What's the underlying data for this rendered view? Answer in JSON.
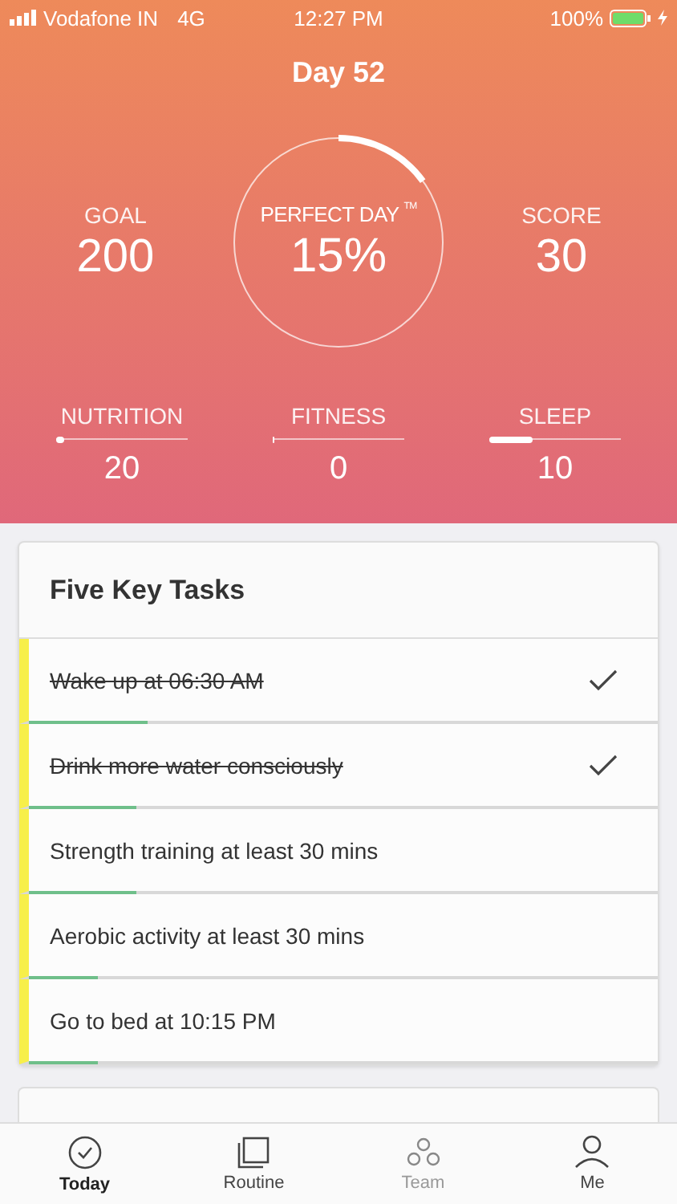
{
  "status_bar": {
    "carrier": "Vodafone IN",
    "network": "4G",
    "time": "12:27 PM",
    "battery": "100%"
  },
  "header": {
    "title": "Day 52",
    "goal": {
      "label": "GOAL",
      "value": "200"
    },
    "perfect_day": {
      "label": "PERFECT DAY",
      "mark": "TM",
      "value": "15%",
      "level": 0.15
    },
    "score": {
      "label": "SCORE",
      "value": "30"
    },
    "categories": [
      {
        "label": "NUTRITION",
        "level": 0.06,
        "value": "20"
      },
      {
        "label": "FITNESS",
        "level": 0,
        "value": "0"
      },
      {
        "label": "SLEEP",
        "level": 0.33,
        "value": "10"
      }
    ]
  },
  "task_card": {
    "title": "Five Key Tasks",
    "tasks": [
      {
        "text": "Wake up at 06:30 AM",
        "done": true,
        "level": 0.19
      },
      {
        "text": "Drink more water consciously",
        "done": true,
        "level": 0.17
      },
      {
        "text": "Strength training at least 30 mins",
        "done": false,
        "level": 0.17
      },
      {
        "text": "Aerobic activity at least 30 mins",
        "done": false,
        "level": 0.11
      },
      {
        "text": "Go to bed at 10:15 PM",
        "done": false,
        "level": 0.11
      }
    ]
  },
  "tab_bar": [
    {
      "label": "Today",
      "kind": "today",
      "selected": true,
      "disabled": false
    },
    {
      "label": "Routine",
      "kind": "routine",
      "selected": false,
      "disabled": false
    },
    {
      "label": "Team",
      "kind": "team",
      "selected": false,
      "disabled": true
    },
    {
      "label": "Me",
      "kind": "me",
      "selected": false,
      "disabled": false
    }
  ]
}
